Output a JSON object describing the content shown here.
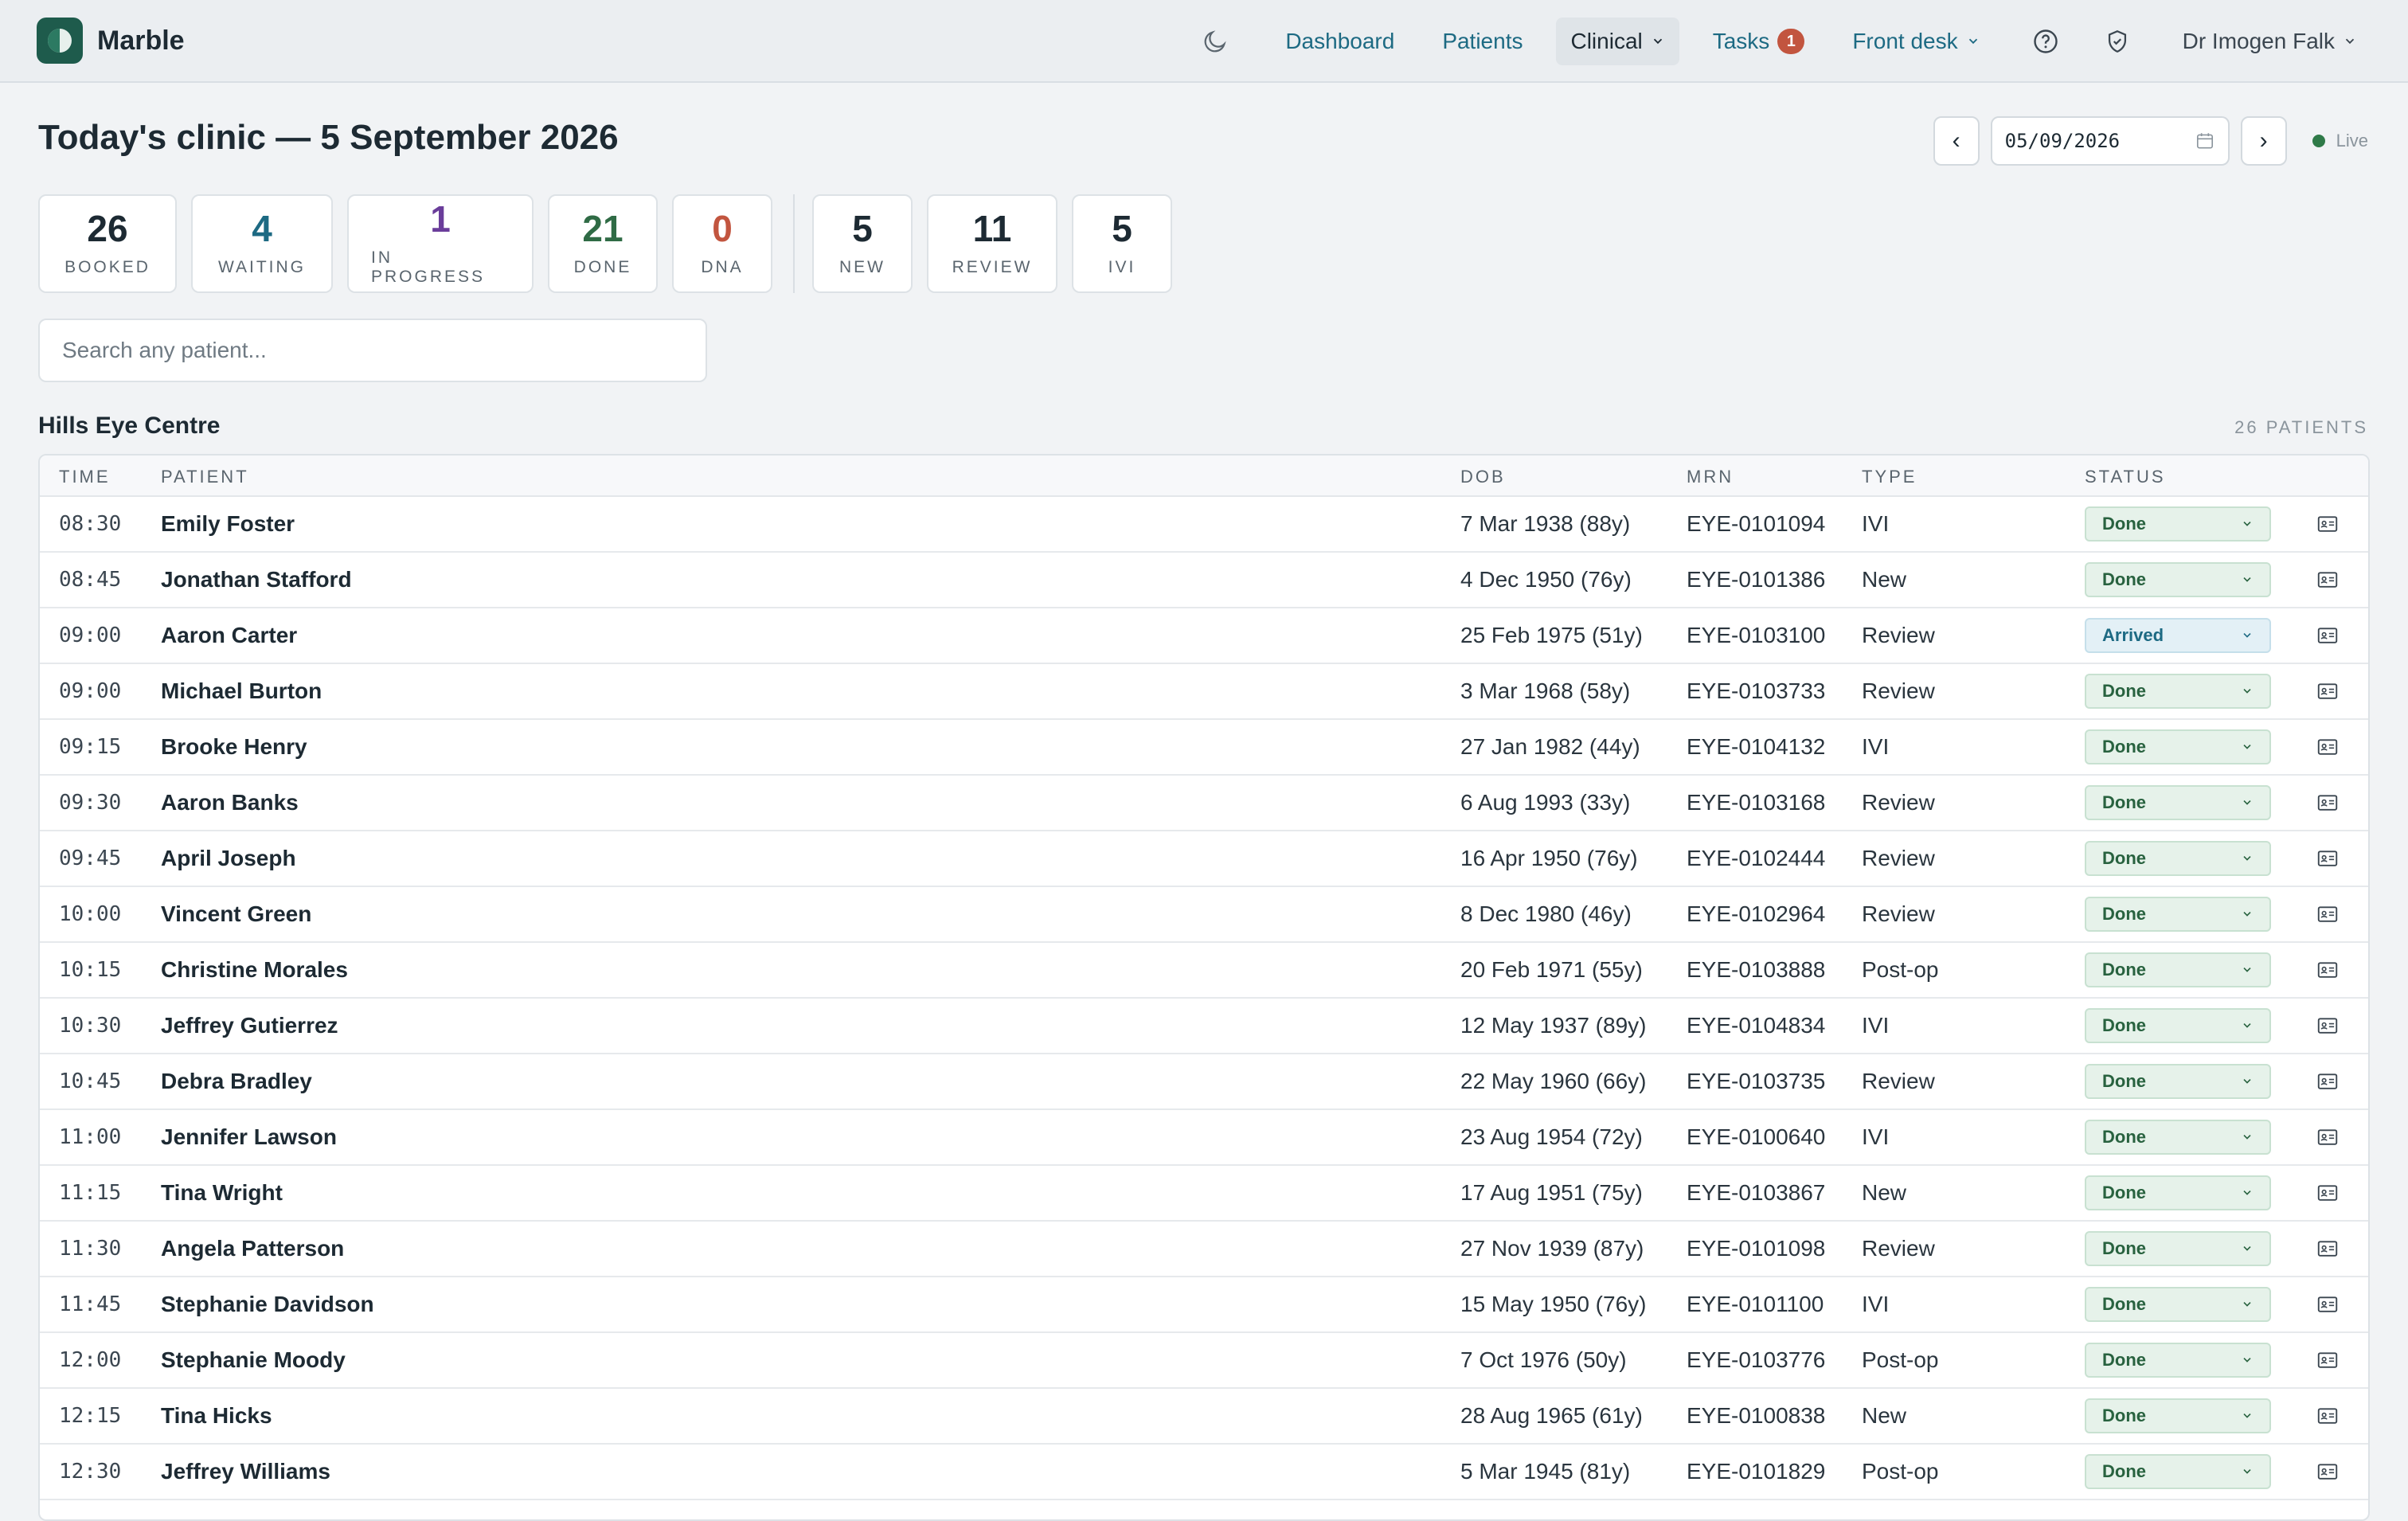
{
  "app": {
    "name": "Marble"
  },
  "nav": {
    "items": [
      {
        "label": "Dashboard"
      },
      {
        "label": "Patients"
      },
      {
        "label": "Clinical"
      },
      {
        "label": "Tasks",
        "badge": "1"
      },
      {
        "label": "Front desk"
      }
    ],
    "theme_icon": "moon-icon",
    "help_icon": "help-circle-icon",
    "security_icon": "shield-check-icon",
    "user": "Dr Imogen Falk"
  },
  "header": {
    "title": "Today's clinic — 5 September 2026",
    "date_value": "05/09/2026",
    "prev_label": "‹",
    "next_label": "›",
    "live_label": "Live"
  },
  "stats": [
    {
      "value": "26",
      "label": "BOOKED",
      "color": "#1d2a33"
    },
    {
      "value": "4",
      "label": "WAITING",
      "color": "#1d6a83"
    },
    {
      "value": "1",
      "label": "IN PROGRESS",
      "color": "#6a3d9a"
    },
    {
      "value": "21",
      "label": "DONE",
      "color": "#2f6b45"
    },
    {
      "value": "0",
      "label": "DNA",
      "color": "#c2553f"
    },
    {
      "value": "5",
      "label": "NEW",
      "color": "#1d2a33"
    },
    {
      "value": "11",
      "label": "REVIEW",
      "color": "#1d2a33"
    },
    {
      "value": "5",
      "label": "IVI",
      "color": "#1d2a33"
    }
  ],
  "search": {
    "placeholder": "Search any patient..."
  },
  "section": {
    "title": "Hills Eye Centre",
    "count": "26 PATIENTS"
  },
  "table": {
    "columns": {
      "time": "TIME",
      "patient": "PATIENT",
      "dob": "DOB",
      "mrn": "MRN",
      "type": "TYPE",
      "status": "STATUS"
    },
    "rows": [
      {
        "time": "08:30",
        "patient": "Emily Foster",
        "dob": "7 Mar 1938 (88y)",
        "mrn": "EYE-0101094",
        "type": "IVI",
        "status": "Done"
      },
      {
        "time": "08:45",
        "patient": "Jonathan Stafford",
        "dob": "4 Dec 1950 (76y)",
        "mrn": "EYE-0101386",
        "type": "New",
        "status": "Done"
      },
      {
        "time": "09:00",
        "patient": "Aaron Carter",
        "dob": "25 Feb 1975 (51y)",
        "mrn": "EYE-0103100",
        "type": "Review",
        "status": "Arrived"
      },
      {
        "time": "09:00",
        "patient": "Michael Burton",
        "dob": "3 Mar 1968 (58y)",
        "mrn": "EYE-0103733",
        "type": "Review",
        "status": "Done"
      },
      {
        "time": "09:15",
        "patient": "Brooke Henry",
        "dob": "27 Jan 1982 (44y)",
        "mrn": "EYE-0104132",
        "type": "IVI",
        "status": "Done"
      },
      {
        "time": "09:30",
        "patient": "Aaron Banks",
        "dob": "6 Aug 1993 (33y)",
        "mrn": "EYE-0103168",
        "type": "Review",
        "status": "Done"
      },
      {
        "time": "09:45",
        "patient": "April Joseph",
        "dob": "16 Apr 1950 (76y)",
        "mrn": "EYE-0102444",
        "type": "Review",
        "status": "Done"
      },
      {
        "time": "10:00",
        "patient": "Vincent Green",
        "dob": "8 Dec 1980 (46y)",
        "mrn": "EYE-0102964",
        "type": "Review",
        "status": "Done"
      },
      {
        "time": "10:15",
        "patient": "Christine Morales",
        "dob": "20 Feb 1971 (55y)",
        "mrn": "EYE-0103888",
        "type": "Post-op",
        "status": "Done"
      },
      {
        "time": "10:30",
        "patient": "Jeffrey Gutierrez",
        "dob": "12 May 1937 (89y)",
        "mrn": "EYE-0104834",
        "type": "IVI",
        "status": "Done"
      },
      {
        "time": "10:45",
        "patient": "Debra Bradley",
        "dob": "22 May 1960 (66y)",
        "mrn": "EYE-0103735",
        "type": "Review",
        "status": "Done"
      },
      {
        "time": "11:00",
        "patient": "Jennifer Lawson",
        "dob": "23 Aug 1954 (72y)",
        "mrn": "EYE-0100640",
        "type": "IVI",
        "status": "Done"
      },
      {
        "time": "11:15",
        "patient": "Tina Wright",
        "dob": "17 Aug 1951 (75y)",
        "mrn": "EYE-0103867",
        "type": "New",
        "status": "Done"
      },
      {
        "time": "11:30",
        "patient": "Angela Patterson",
        "dob": "27 Nov 1939 (87y)",
        "mrn": "EYE-0101098",
        "type": "Review",
        "status": "Done"
      },
      {
        "time": "11:45",
        "patient": "Stephanie Davidson",
        "dob": "15 May 1950 (76y)",
        "mrn": "EYE-0101100",
        "type": "IVI",
        "status": "Done"
      },
      {
        "time": "12:00",
        "patient": "Stephanie Moody",
        "dob": "7 Oct 1976 (50y)",
        "mrn": "EYE-0103776",
        "type": "Post-op",
        "status": "Done"
      },
      {
        "time": "12:15",
        "patient": "Tina Hicks",
        "dob": "28 Aug 1965 (61y)",
        "mrn": "EYE-0100838",
        "type": "New",
        "status": "Done"
      },
      {
        "time": "12:30",
        "patient": "Jeffrey Williams",
        "dob": "5 Mar 1945 (81y)",
        "mrn": "EYE-0101829",
        "type": "Post-op",
        "status": "Done"
      }
    ]
  }
}
